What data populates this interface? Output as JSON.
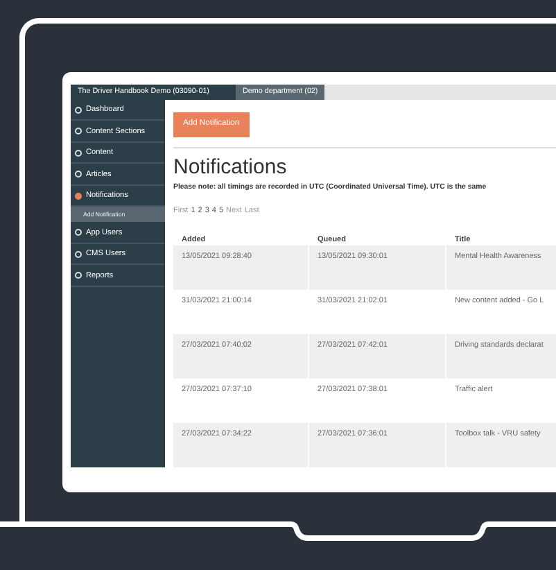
{
  "app_tabs": [
    {
      "label": "The Driver Handbook Demo (03090-01)",
      "selected": true
    },
    {
      "label": "Demo department (02)",
      "selected": false
    }
  ],
  "sidebar": {
    "items": [
      {
        "label": "Dashboard",
        "selected": false
      },
      {
        "label": "Content Sections",
        "selected": false
      },
      {
        "label": "Content",
        "selected": false
      },
      {
        "label": "Articles",
        "selected": false
      },
      {
        "label": "Notifications",
        "selected": true,
        "children": [
          {
            "label": "Add Notification"
          }
        ]
      },
      {
        "label": "App Users",
        "selected": false
      },
      {
        "label": "CMS Users",
        "selected": false
      },
      {
        "label": "Reports",
        "selected": false
      }
    ]
  },
  "add_button": "Add Notification",
  "title": "Notifications",
  "note": "Please note: all timings are recorded in UTC (Coordinated Universal Time). UTC is the same",
  "pager": [
    {
      "label": "First",
      "kind": "nav"
    },
    {
      "label": "1",
      "kind": "page"
    },
    {
      "label": "2",
      "kind": "page"
    },
    {
      "label": "3",
      "kind": "page"
    },
    {
      "label": "4",
      "kind": "page"
    },
    {
      "label": "5",
      "kind": "page"
    },
    {
      "label": "Next",
      "kind": "nav"
    },
    {
      "label": "Last",
      "kind": "nav"
    }
  ],
  "table": {
    "columns": [
      "Added",
      "Queued",
      "Title"
    ],
    "rows": [
      [
        "13/05/2021 09:28:40",
        "13/05/2021 09:30:01",
        "Mental Health Awareness"
      ],
      [
        "31/03/2021 21:00:14",
        "31/03/2021 21:02:01",
        "New content added - Go L"
      ],
      [
        "27/03/2021 07:40:02",
        "27/03/2021 07:42:01",
        "Driving standards declarat"
      ],
      [
        "27/03/2021 07:37:10",
        "27/03/2021 07:38:01",
        "Traffic alert"
      ],
      [
        "27/03/2021 07:34:22",
        "27/03/2021 07:36:01",
        "Toolbox talk - VRU safety"
      ]
    ]
  }
}
